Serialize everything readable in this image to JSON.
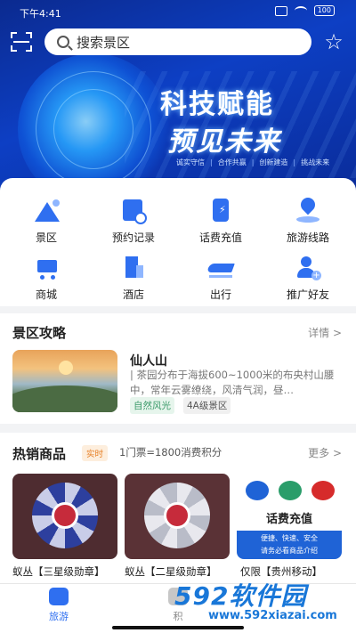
{
  "status": {
    "time": "下午4:41",
    "battery": "100"
  },
  "header": {
    "search_placeholder": "搜索景区"
  },
  "banner": {
    "headline": "科技赋能",
    "subline": "预见未来",
    "tags": [
      "诚实守信",
      "合作共赢",
      "创新建造",
      "挑战未来"
    ]
  },
  "menu": {
    "items": [
      {
        "label": "景区",
        "icon": "mountain-icon"
      },
      {
        "label": "预约记录",
        "icon": "calendar-clock-icon"
      },
      {
        "label": "话费充值",
        "icon": "phone-charge-icon"
      },
      {
        "label": "旅游线路",
        "icon": "map-pin-icon"
      },
      {
        "label": "商城",
        "icon": "cart-icon"
      },
      {
        "label": "酒店",
        "icon": "building-icon"
      },
      {
        "label": "出行",
        "icon": "train-icon"
      },
      {
        "label": "推广好友",
        "icon": "add-user-icon"
      }
    ]
  },
  "guide": {
    "title": "景区攻略",
    "more": "详情 >",
    "spot": {
      "name": "仙人山",
      "desc": "| 茶园分布于海拔600~1000米的布央村山腰中，常年云雾缭绕，风清气润，昼…",
      "tag1": "自然风光",
      "tag2": "4A级景区"
    }
  },
  "hot": {
    "title": "热销商品",
    "badge": "实时",
    "note": "1门票=1800消费积分",
    "more": "更多 >",
    "products": [
      {
        "name": "蚁丛【三星级勋章】"
      },
      {
        "name": "蚁丛【二星级勋章】"
      },
      {
        "name": "仅限【贵州移动】",
        "card_title": "话费充值",
        "card_line1": "便捷、快速、安全",
        "card_line2": "请务必看商品介绍"
      }
    ]
  },
  "tabbar": {
    "tab1": "旅游",
    "tab2": "积"
  },
  "watermark": {
    "text": "592软件园",
    "url": "www.592xiazai.com"
  },
  "colors": {
    "primary": "#2f6ff0",
    "banner": "#0d3fc4"
  }
}
